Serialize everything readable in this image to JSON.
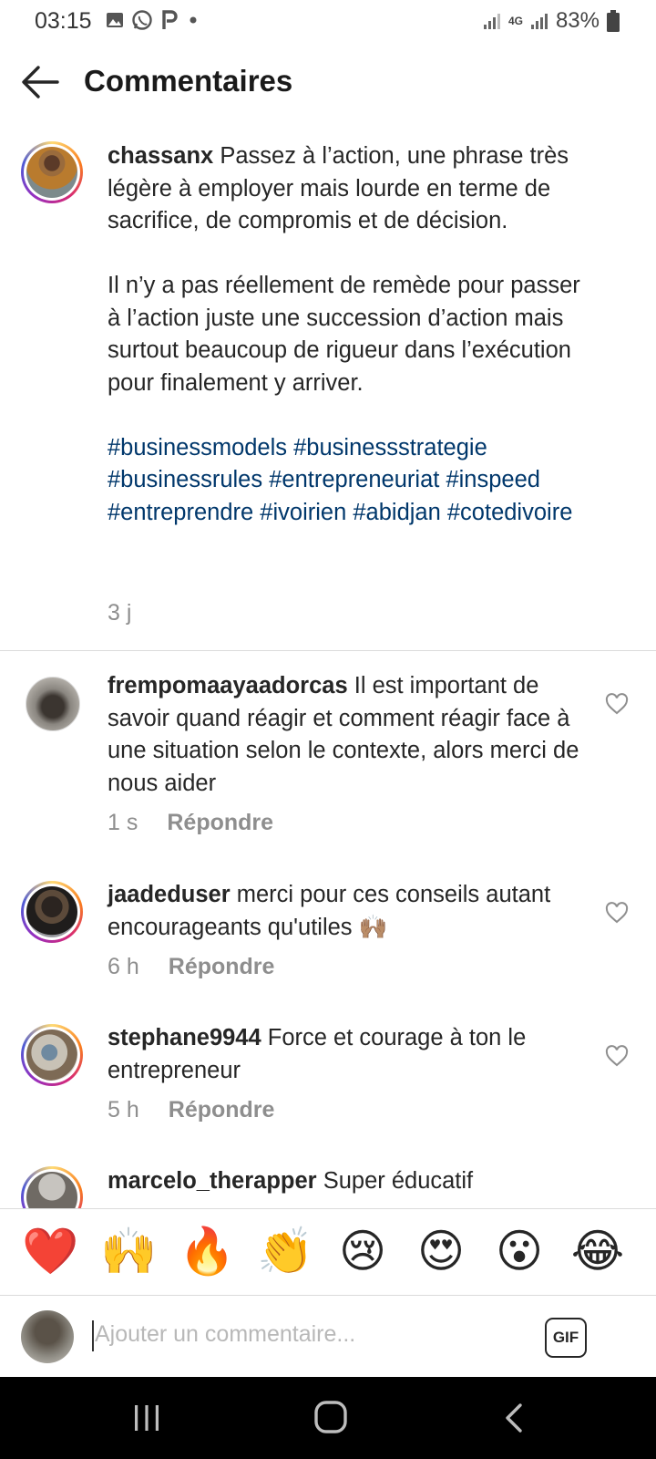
{
  "status": {
    "time": "03:15",
    "network": "4G",
    "battery": "83%"
  },
  "header": {
    "title": "Commentaires"
  },
  "caption": {
    "username": "chassanx",
    "para1": "Passez à l’action, une phrase très légère à employer mais lourde en terme de sacrifice, de compromis et de décision.",
    "para2": "Il n’y a pas réellement de remède pour passer à l’action juste une succession d’action mais surtout beaucoup de rigueur dans l’exécution pour finalement y arriver.",
    "hashtags": [
      "#businessmodels",
      "#businessstrategie",
      "#businessrules",
      "#entrepreneuriat",
      "#inspeed",
      "#entreprendre",
      "#ivoirien",
      "#abidjan",
      "#cotedivoire"
    ],
    "time": "3 j"
  },
  "comments": [
    {
      "username": "frempomaayaadorcas",
      "text": "Il est important de savoir quand réagir et comment réagir face à une situation selon le contexte, alors merci de nous aider",
      "time": "1 s",
      "reply": "Répondre"
    },
    {
      "username": "jaadeduser",
      "text": "merci pour ces conseils autant encourageants qu'utiles 🙌🏽",
      "time": "6 h",
      "reply": "Répondre"
    },
    {
      "username": "stephane9944",
      "text": "Force et courage à ton le entrepreneur",
      "time": "5 h",
      "reply": "Répondre"
    },
    {
      "username": "marcelo_therapper",
      "text": "Super éducatif"
    }
  ],
  "emoji_bar": [
    "❤️",
    "🙌",
    "🔥",
    "👏",
    "😢",
    "😍",
    "😮",
    "😂"
  ],
  "composer": {
    "placeholder": "Ajouter un commentaire...",
    "gif_label": "GIF"
  },
  "icons": {
    "back": "arrow-left-icon",
    "heart": "heart-outline-icon",
    "nav_recents": "recent-apps-icon",
    "nav_home": "home-icon",
    "nav_back": "back-icon"
  }
}
